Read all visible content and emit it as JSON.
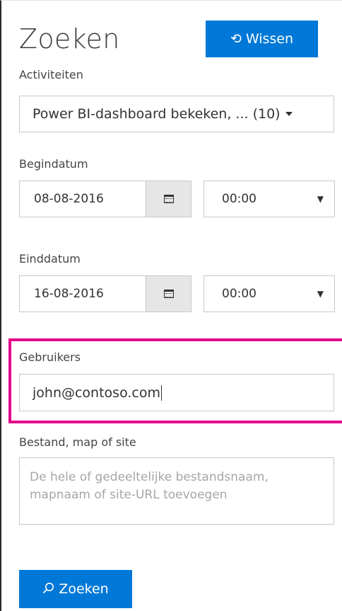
{
  "header": {
    "title": "Zoeken",
    "clear_label": "Wissen"
  },
  "activities": {
    "label": "Activiteiten",
    "selected": "Power BI-dashboard bekeken, ... (10)"
  },
  "start": {
    "label": "Begindatum",
    "date": "08-08-2016",
    "time": "00:00"
  },
  "end": {
    "label": "Einddatum",
    "date": "16-08-2016",
    "time": "00:00"
  },
  "users": {
    "label": "Gebruikers",
    "value": "john@contoso.com"
  },
  "file": {
    "label": "Bestand, map of site",
    "placeholder": "De hele of gedeeltelijke bestandsnaam, mapnaam of site-URL toevoegen"
  },
  "search": {
    "button_label": "Zoeken"
  },
  "colors": {
    "accent": "#0078d7",
    "highlight": "#e3008c"
  },
  "icons": {
    "clear": "undo-icon",
    "calendar": "calendar-icon",
    "search": "search-icon"
  }
}
